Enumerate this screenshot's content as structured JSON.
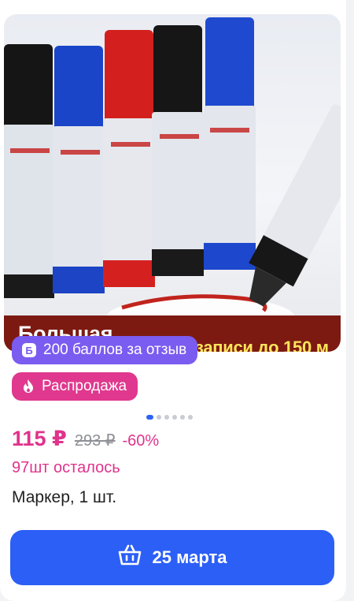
{
  "banner": {
    "left_text": "Большая",
    "right_text": "Длина записи до 150 м"
  },
  "badges": {
    "bonus_label": "200 баллов за отзыв",
    "bonus_icon_text": "Б",
    "sale_label": "Распродажа"
  },
  "gallery": {
    "total": 6,
    "current": 1
  },
  "price": {
    "current": "115 ₽",
    "old": "293 ₽",
    "discount": "-60%"
  },
  "stock": "97шт осталось",
  "product": {
    "title": "Маркер, 1 шт."
  },
  "cta": {
    "label": "25 марта",
    "icon": "basket-icon"
  },
  "colors": {
    "accent": "#2c5ff6",
    "sale": "#e0388e",
    "bonus": "#7b5cf0",
    "price": "#e0338c"
  }
}
